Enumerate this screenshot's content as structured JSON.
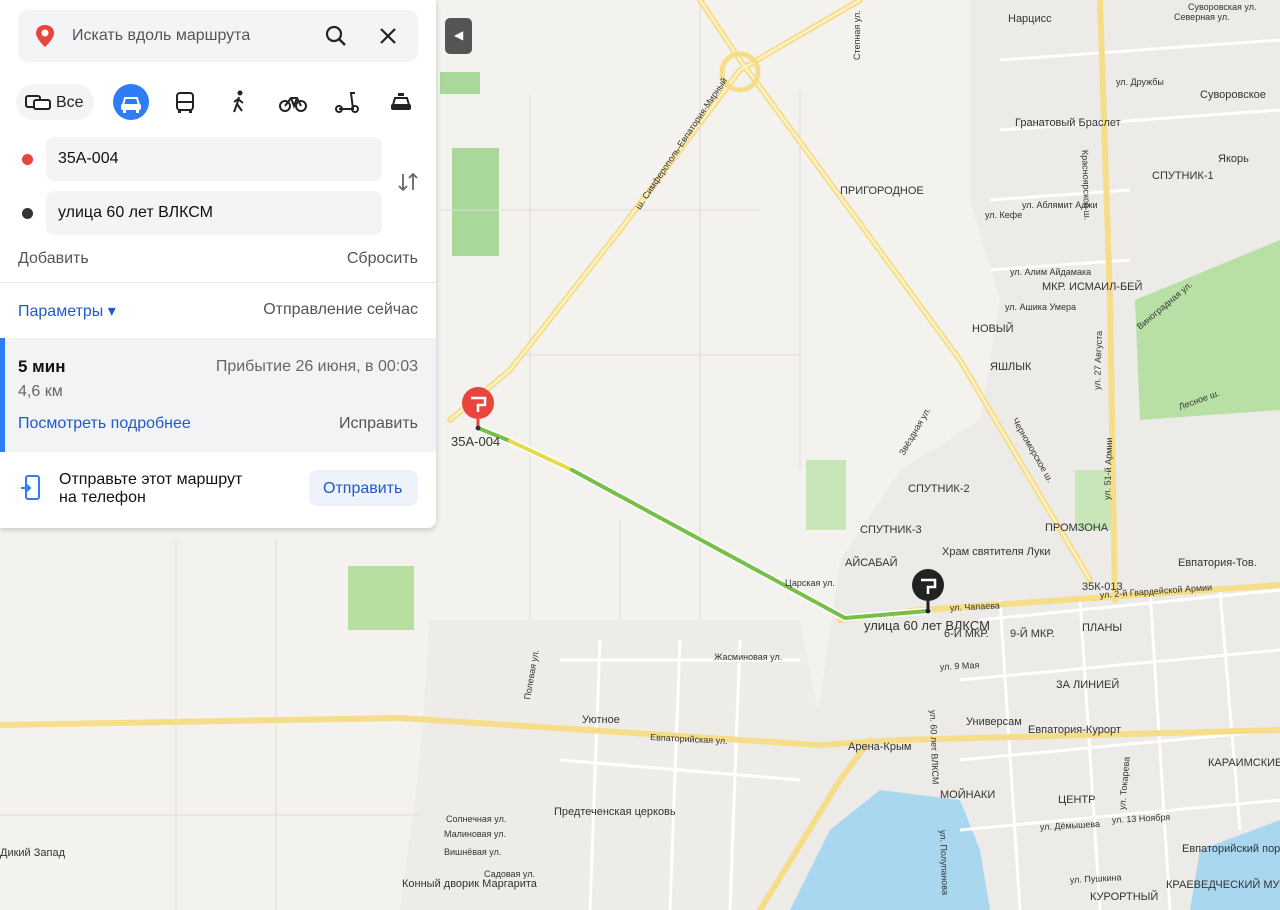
{
  "search": {
    "placeholder": "Искать вдоль маршрута"
  },
  "modes": {
    "all_label": "Все",
    "active": "car",
    "items": [
      "car",
      "bus",
      "walk",
      "bike",
      "scooter",
      "taxi"
    ]
  },
  "route": {
    "from": "35А-004",
    "to": "улица 60 лет ВЛКСМ",
    "add_label": "Добавить",
    "reset_label": "Сбросить",
    "params_label": "Параметры ▾",
    "departure_label": "Отправление сейчас",
    "duration": "5 мин",
    "distance": "4,6 км",
    "arrival": "Прибытие 26 июня, в 00:03",
    "details_link": "Посмотреть подробнее",
    "fix_label": "Исправить",
    "send_text_line1": "Отправьте этот маршрут",
    "send_text_line2": "на телефон",
    "send_button": "Отправить"
  },
  "colors": {
    "accent": "#2e7cf6",
    "start_dot": "#e8453c",
    "end_dot": "#333333",
    "route_green": "#76c04a",
    "route_yellow": "#e6d94a"
  },
  "map": {
    "start_label": "35А-004",
    "end_label": "улица 60 лет ВЛКСМ",
    "places": [
      "Нарцисс",
      "Суворовское",
      "Гранатовый Браслет",
      "Якорь",
      "ПРИГОРОДНОЕ",
      "СПУТНИК-1",
      "МКР. ИСМАИЛ-БЕЙ",
      "НОВЫЙ",
      "ЯШЛЫК",
      "СПУТНИК-2",
      "СПУТНИК-3",
      "АЙСАБАЙ",
      "ПРОМЗОНА",
      "Храм святителя Луки",
      "Евпатория-Тов.",
      "Уютное",
      "Арена-Крым",
      "Универсам",
      "Евпатория-Курорт",
      "ЗА ЛИНИЕЙ",
      "ПЛАНЫ",
      "9-Й МКР.",
      "6-Й МКР.",
      "МОЙНАКИ",
      "ЦЕНТР",
      "КУРОРТНЫЙ",
      "КАРАИМСКИЕ КЕНАСЫ",
      "Евпаторийский пор",
      "КРАЕВЕДЧЕСКИЙ МУЗЕЙ",
      "Предтеченская церковь",
      "Конный дворик Маргарита",
      "Дикий Запад",
      "35К-013"
    ],
    "roads": [
      "ш. Симферополь-Евпатория-Мирный",
      "Черноморское ш.",
      "Красноярское ш.",
      "ул. 27 Августа",
      "ул. 51-й Армии",
      "Виноградная ул.",
      "Лесное ш.",
      "ул. 2-й Гвардейской Армии",
      "ул. Чапаева",
      "ул. 9 Мая",
      "ул. 60 лет ВЛКСМ",
      "Евпаторийская ул.",
      "ул. Полупанова",
      "ул. Дёмышева",
      "ул. Пушкина",
      "ул. Токарева",
      "ул. 13 Ноября",
      "Царская ул.",
      "Жасминовая ул.",
      "Солнечная ул.",
      "Малиновая ул.",
      "Вишнёвая ул.",
      "Садовая ул.",
      "Северная ул.",
      "ул. Дружбы",
      "Суворовская ул.",
      "ул. Аблямит Аджи",
      "ул. Кефе",
      "ул. Ашика Умера",
      "ул. Алим Айдамака",
      "Степная ул.",
      "Звёздная ул.",
      "Полевая ул."
    ]
  }
}
